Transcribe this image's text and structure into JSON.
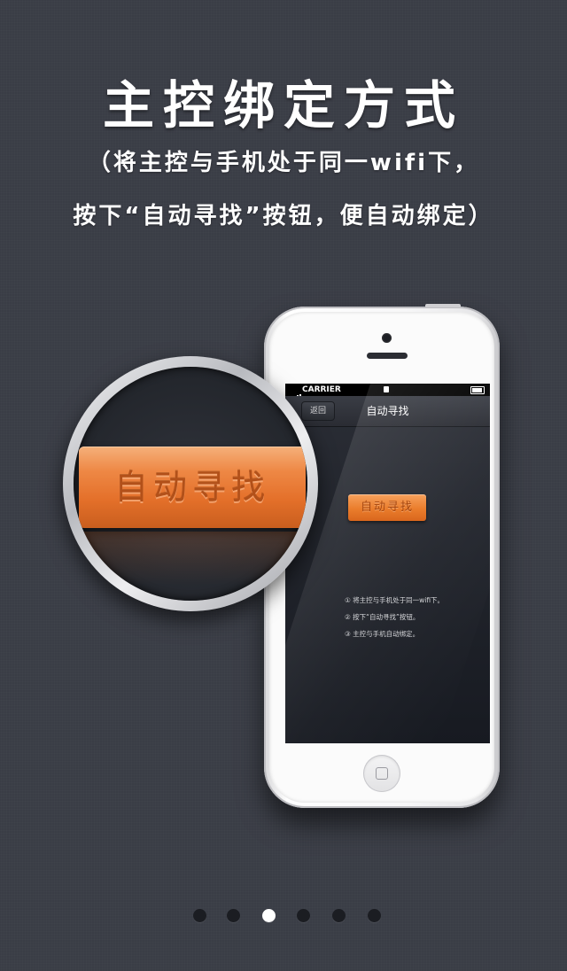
{
  "header": {
    "title": "主控绑定方式",
    "subtitle_line1": "（将主控与手机处于同一wifi下，",
    "subtitle_line2": "按下“自动寻找”按钮，便自动绑定）"
  },
  "phone": {
    "status_bar": {
      "carrier": "CARRIER"
    },
    "nav": {
      "back_label": "返回",
      "title": "自动寻找"
    },
    "action_button_label": "自动寻找",
    "steps": [
      "① 将主控与手机处于同一wifi下。",
      "② 按下“自动寻找”按钮。",
      "③ 主控与手机自动绑定。"
    ]
  },
  "magnifier": {
    "button_label": "自动寻找"
  },
  "pagination": {
    "count": 6,
    "active_index": 2
  },
  "colors": {
    "background": "#3a3d46",
    "accent_orange": "#ea7d2c",
    "dot_inactive": "#1b1d22",
    "dot_active": "#ffffff"
  }
}
